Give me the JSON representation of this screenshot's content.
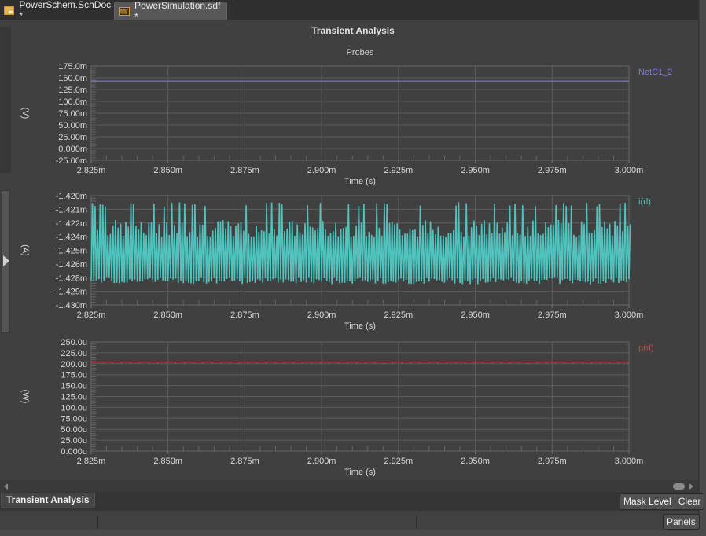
{
  "tabs": [
    {
      "label": "PowerSchem.SchDoc *",
      "icon": "schematic-doc-icon",
      "active": false
    },
    {
      "label": "PowerSimulation.sdf *",
      "icon": "simulation-waveform-icon",
      "active": true
    }
  ],
  "document": {
    "title": "Transient Analysis",
    "subtitle": "Probes"
  },
  "chart_data": [
    {
      "type": "line",
      "title": "Probes",
      "xlabel": "Time (s)",
      "ylabel": "(V)",
      "xlim": [
        2.825,
        3.0
      ],
      "x_unit": "ms",
      "ylim": [
        -25,
        175
      ],
      "y_unit": "mV",
      "grid": true,
      "legend_placement": "right",
      "x_ticks": [
        "2.825m",
        "2.850m",
        "2.875m",
        "2.900m",
        "2.925m",
        "2.950m",
        "2.975m",
        "3.000m"
      ],
      "y_ticks": [
        "175.0m",
        "150.0m",
        "125.0m",
        "100.0m",
        "75.00m",
        "50.00m",
        "25.00m",
        "0.000m",
        "-25.00m"
      ],
      "series": [
        {
          "name": "NetC1_2",
          "color": "#7b78d8",
          "shape": "constant",
          "value": 143
        }
      ]
    },
    {
      "type": "line",
      "xlabel": "Time (s)",
      "ylabel": "(A)",
      "xlim": [
        2.825,
        3.0
      ],
      "x_unit": "ms",
      "ylim": [
        -1.43,
        -1.42
      ],
      "y_unit": "mA",
      "grid": true,
      "legend_placement": "right",
      "x_ticks": [
        "2.825m",
        "2.850m",
        "2.875m",
        "2.900m",
        "2.925m",
        "2.950m",
        "2.975m",
        "3.000m"
      ],
      "y_ticks": [
        "-1.420m",
        "-1.421m",
        "-1.422m",
        "-1.424m",
        "-1.425m",
        "-1.426m",
        "-1.428m",
        "-1.429m",
        "-1.430m"
      ],
      "series": [
        {
          "name": "i(rl)",
          "color": "#4fc4be",
          "shape": "oscillating",
          "min": -1.4279,
          "max": -1.4206,
          "typical_low": -1.4278,
          "typical_high": -1.423,
          "cycles": 210
        }
      ]
    },
    {
      "type": "line",
      "xlabel": "Time (s)",
      "ylabel": "(W)",
      "xlim": [
        2.825,
        3.0
      ],
      "x_unit": "ms",
      "ylim": [
        0,
        250
      ],
      "y_unit": "uW",
      "grid": true,
      "legend_placement": "right",
      "x_ticks": [
        "2.825m",
        "2.850m",
        "2.875m",
        "2.900m",
        "2.925m",
        "2.950m",
        "2.975m",
        "3.000m"
      ],
      "y_ticks": [
        "250.0u",
        "225.0u",
        "200.0u",
        "175.0u",
        "150.0u",
        "125.0u",
        "100.0u",
        "75.00u",
        "50.00u",
        "25.00u",
        "0.000u"
      ],
      "series": [
        {
          "name": "p(rl)",
          "color": "#c8474a",
          "shape": "constant",
          "value": 204
        }
      ]
    }
  ],
  "bottom_panel": {
    "tab_label": "Transient Analysis",
    "mask_level_label": "Mask Level",
    "clear_label": "Clear"
  },
  "status_bar": {
    "panels_label": "Panels"
  }
}
